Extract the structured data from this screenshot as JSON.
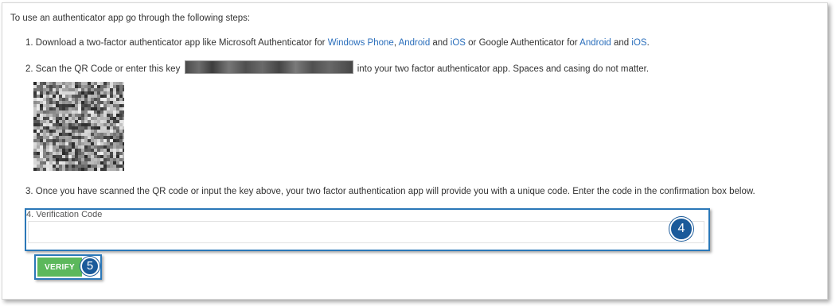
{
  "intro": "To use an authenticator app go through the following steps:",
  "step1": {
    "text_a": "1. Download a two-factor authenticator app like Microsoft Authenticator for ",
    "link_windows_phone": "Windows Phone",
    "sep1": ", ",
    "link_android_1": "Android",
    "and1": " and ",
    "link_ios_1": "iOS",
    "text_b": " or Google Authenticator for ",
    "link_android_2": "Android",
    "and2": " and ",
    "link_ios_2": "iOS",
    "end": "."
  },
  "step2": {
    "text_a": "2. Scan the QR Code or enter this key ",
    "text_b": " into your two factor authenticator app. Spaces and casing do not matter."
  },
  "step3": "3. Once you have scanned the QR code or input the key above, your two factor authentication app will provide you with a unique code. Enter the code in the confirmation box below.",
  "verification": {
    "label": "4. Verification Code",
    "value": "",
    "badge": "4"
  },
  "verify_button": {
    "label": "VERIFY",
    "badge": "5"
  },
  "colors": {
    "link": "#2a6ebb",
    "highlight_border": "#2b78b8",
    "badge_bg": "#1a5a9a",
    "verify_bg": "#5cb85c"
  }
}
